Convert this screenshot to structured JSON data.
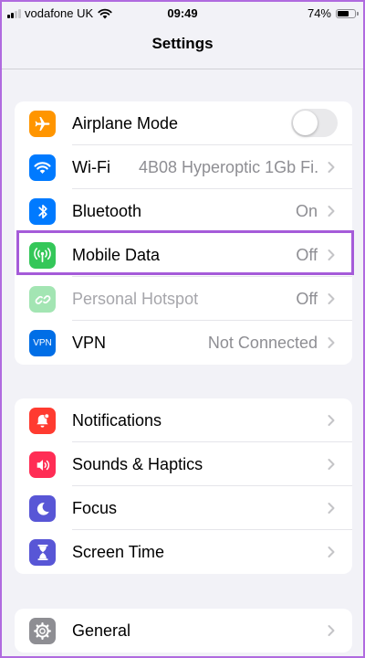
{
  "status_bar": {
    "carrier": "vodafone UK",
    "time": "09:49",
    "battery_percent_label": "74%",
    "battery_level": 0.74
  },
  "nav": {
    "title": "Settings"
  },
  "groups": [
    {
      "rows": [
        {
          "label": "Airplane Mode",
          "icon": "airplane-icon",
          "color": "#ff9500",
          "toggle_on": false
        },
        {
          "label": "Wi-Fi",
          "value": "4B08 Hyperoptic 1Gb Fi...",
          "icon": "wifi-icon",
          "color": "#007aff"
        },
        {
          "label": "Bluetooth",
          "value": "On",
          "icon": "bluetooth-icon",
          "color": "#007aff"
        },
        {
          "label": "Mobile Data",
          "value": "Off",
          "icon": "antenna-icon",
          "color": "#34c759",
          "highlighted": true
        },
        {
          "label": "Personal Hotspot",
          "value": "Off",
          "icon": "hotspot-link-icon",
          "color": "#34c759",
          "disabled": true
        },
        {
          "label": "VPN",
          "value": "Not Connected",
          "icon": "vpn-icon",
          "icon_text": "VPN",
          "color": "#006ee6"
        }
      ]
    },
    {
      "rows": [
        {
          "label": "Notifications",
          "icon": "bell-icon",
          "color": "#ff3b30"
        },
        {
          "label": "Sounds & Haptics",
          "icon": "speaker-icon",
          "color": "#ff2d55"
        },
        {
          "label": "Focus",
          "icon": "moon-icon",
          "color": "#5856d6"
        },
        {
          "label": "Screen Time",
          "icon": "hourglass-icon",
          "color": "#5856d6"
        }
      ]
    },
    {
      "rows": [
        {
          "label": "General",
          "icon": "gear-icon",
          "color": "#8e8e93"
        }
      ]
    }
  ]
}
